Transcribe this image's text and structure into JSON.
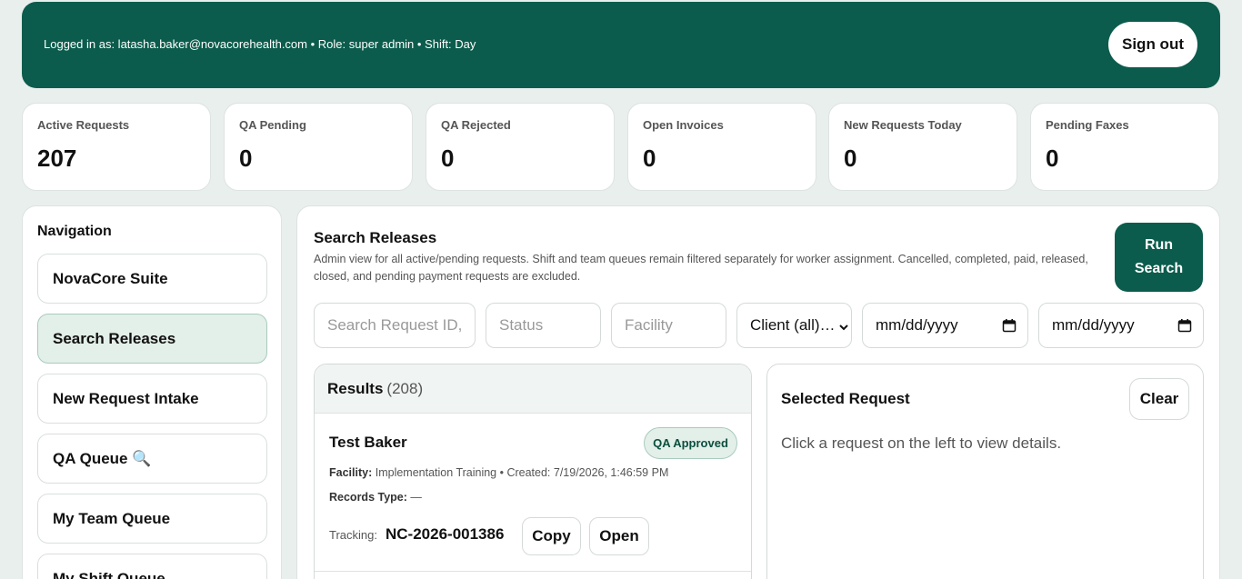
{
  "header": {
    "login_text": "Logged in as: latasha.baker@novacorehealth.com • Role: super admin • Shift: Day",
    "signout_label": "Sign out"
  },
  "stats": [
    {
      "label": "Active Requests",
      "value": "207"
    },
    {
      "label": "QA Pending",
      "value": "0"
    },
    {
      "label": "QA Rejected",
      "value": "0"
    },
    {
      "label": "Open Invoices",
      "value": "0"
    },
    {
      "label": "New Requests Today",
      "value": "0"
    },
    {
      "label": "Pending Faxes",
      "value": "0"
    }
  ],
  "nav": {
    "title": "Navigation",
    "items": [
      {
        "label": "NovaCore Suite"
      },
      {
        "label": "Search Releases"
      },
      {
        "label": "New Request Intake"
      },
      {
        "label": "QA Queue 🔍"
      },
      {
        "label": "My Team Queue"
      },
      {
        "label": "My Shift Queue"
      }
    ]
  },
  "main": {
    "title": "Search Releases",
    "description": "Admin view for all active/pending requests. Shift and team queues remain filtered separately for worker assignment. Cancelled, completed, paid, released, closed, and pending payment requests are excluded.",
    "run_line1": "Run",
    "run_line2": "Search"
  },
  "filters": {
    "search_placeholder": "Search Request ID,",
    "status_placeholder": "Status",
    "facility_placeholder": "Facility",
    "client_value": "Client (all)…",
    "date_from": "mm/dd/yyyy",
    "date_to": "mm/dd/yyyy"
  },
  "results": {
    "title": "Results",
    "count": "(208)",
    "item": {
      "name": "Test Baker",
      "badge": "QA Approved",
      "facility_label": "Facility:",
      "facility_text": "Implementation Training • Created: 7/19/2026, 1:46:59 PM",
      "records_label": "Records Type:",
      "records_value": "—",
      "tracking_label": "Tracking:",
      "tracking_number": "NC-2026-001386",
      "copy_label": "Copy",
      "open_label": "Open"
    }
  },
  "selected": {
    "title": "Selected Request",
    "clear_label": "Clear",
    "hint": "Click a request on the left to view details."
  }
}
